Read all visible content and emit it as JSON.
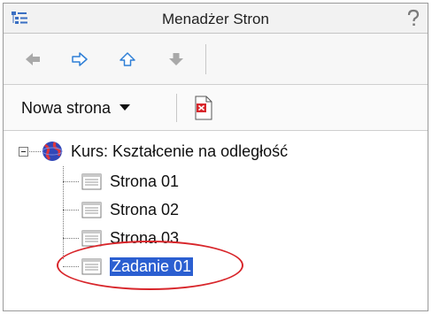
{
  "window": {
    "title": "Menadżer Stron",
    "icons": {
      "title": "tree-list-icon",
      "help": "help-icon"
    }
  },
  "navigation": {
    "buttons": [
      {
        "name": "back",
        "icon": "arrow-left-icon",
        "enabled": false
      },
      {
        "name": "forward",
        "icon": "arrow-right-icon",
        "enabled": true
      },
      {
        "name": "up",
        "icon": "arrow-up-icon",
        "enabled": true
      },
      {
        "name": "down",
        "icon": "arrow-down-icon",
        "enabled": false
      }
    ]
  },
  "toolbar": {
    "new_page_label": "Nowa strona",
    "dropdown_icon": "chevron-down-icon",
    "delete_icon": "page-delete-icon"
  },
  "tree": {
    "root": {
      "label": "Kurs: Kształcenie na odległość",
      "icon": "globe-icon",
      "expanded": true
    },
    "children": [
      {
        "label": "Strona 01",
        "icon": "page-icon",
        "selected": false
      },
      {
        "label": "Strona 02",
        "icon": "page-icon",
        "selected": false
      },
      {
        "label": "Strona 03",
        "icon": "page-icon",
        "selected": false
      },
      {
        "label": "Zadanie 01",
        "icon": "page-icon",
        "selected": true
      }
    ]
  },
  "colors": {
    "selection": "#2b5fd1",
    "highlight_ellipse": "#d8262b",
    "nav_arrow": "#2f7fd6",
    "nav_arrow_disabled": "#a9a9a9"
  }
}
